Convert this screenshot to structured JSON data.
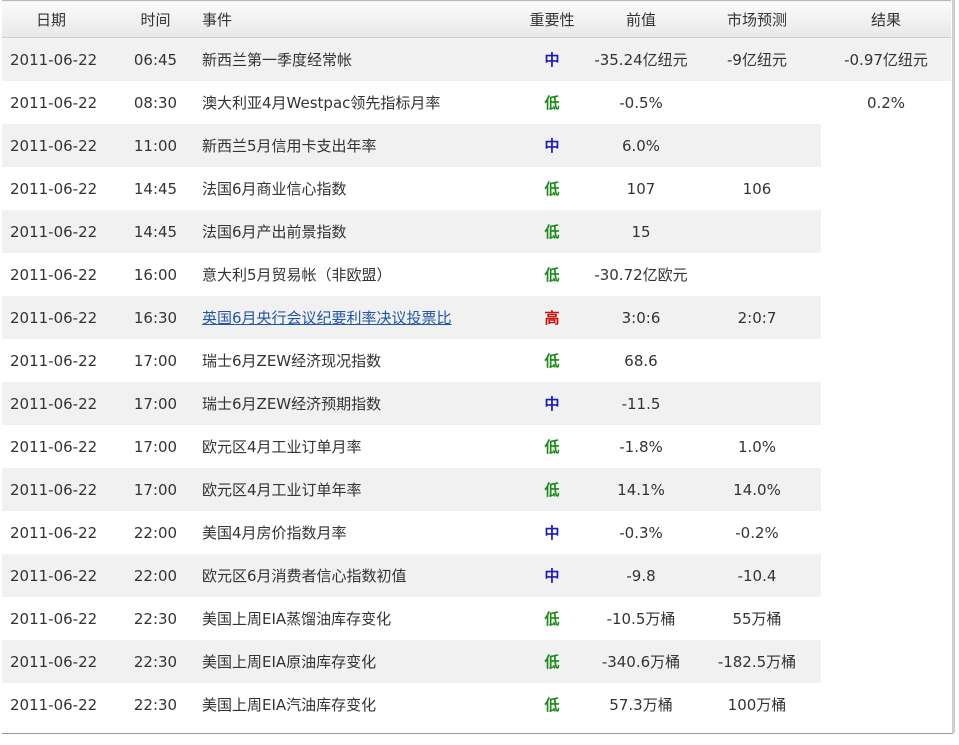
{
  "headers": {
    "date": "日期",
    "time": "时间",
    "event": "事件",
    "importance": "重要性",
    "previous": "前值",
    "forecast": "市场预测",
    "result": "结果"
  },
  "importance_colors": {
    "低": "#1b8a1b",
    "中": "#1a1ab8",
    "高": "#cc1111"
  },
  "rows": [
    {
      "date": "2011-06-22",
      "time": "06:45",
      "event": "新西兰第一季度经常帐",
      "importance": "中",
      "previous": "-35.24亿纽元",
      "forecast": "-9亿纽元",
      "result": "-0.97亿纽元"
    },
    {
      "date": "2011-06-22",
      "time": "08:30",
      "event": "澳大利亚4月Westpac领先指标月率",
      "importance": "低",
      "previous": "-0.5%",
      "forecast": "",
      "result": "0.2%"
    },
    {
      "date": "2011-06-22",
      "time": "11:00",
      "event": "新西兰5月信用卡支出年率",
      "importance": "中",
      "previous": "6.0%",
      "forecast": "",
      "result": ""
    },
    {
      "date": "2011-06-22",
      "time": "14:45",
      "event": "法国6月商业信心指数",
      "importance": "低",
      "previous": "107",
      "forecast": "106",
      "result": ""
    },
    {
      "date": "2011-06-22",
      "time": "14:45",
      "event": "法国6月产出前景指数",
      "importance": "低",
      "previous": "15",
      "forecast": "",
      "result": ""
    },
    {
      "date": "2011-06-22",
      "time": "16:00",
      "event": "意大利5月贸易帐（非欧盟）",
      "importance": "低",
      "previous": "-30.72亿欧元",
      "forecast": "",
      "result": ""
    },
    {
      "date": "2011-06-22",
      "time": "16:30",
      "event": "英国6月央行会议纪要利率决议投票比",
      "importance": "高",
      "previous": "3:0:6",
      "forecast": "2:0:7",
      "result": "",
      "link": true
    },
    {
      "date": "2011-06-22",
      "time": "17:00",
      "event": "瑞士6月ZEW经济现况指数",
      "importance": "低",
      "previous": "68.6",
      "forecast": "",
      "result": ""
    },
    {
      "date": "2011-06-22",
      "time": "17:00",
      "event": "瑞士6月ZEW经济预期指数",
      "importance": "中",
      "previous": "-11.5",
      "forecast": "",
      "result": ""
    },
    {
      "date": "2011-06-22",
      "time": "17:00",
      "event": "欧元区4月工业订单月率",
      "importance": "低",
      "previous": "-1.8%",
      "forecast": "1.0%",
      "result": ""
    },
    {
      "date": "2011-06-22",
      "time": "17:00",
      "event": "欧元区4月工业订单年率",
      "importance": "低",
      "previous": "14.1%",
      "forecast": "14.0%",
      "result": ""
    },
    {
      "date": "2011-06-22",
      "time": "22:00",
      "event": "美国4月房价指数月率",
      "importance": "中",
      "previous": "-0.3%",
      "forecast": "-0.2%",
      "result": ""
    },
    {
      "date": "2011-06-22",
      "time": "22:00",
      "event": "欧元区6月消费者信心指数初值",
      "importance": "中",
      "previous": "-9.8",
      "forecast": "-10.4",
      "result": ""
    },
    {
      "date": "2011-06-22",
      "time": "22:30",
      "event": "美国上周EIA蒸馏油库存变化",
      "importance": "低",
      "previous": "-10.5万桶",
      "forecast": "55万桶",
      "result": ""
    },
    {
      "date": "2011-06-22",
      "time": "22:30",
      "event": "美国上周EIA原油库存变化",
      "importance": "低",
      "previous": "-340.6万桶",
      "forecast": "-182.5万桶",
      "result": ""
    },
    {
      "date": "2011-06-22",
      "time": "22:30",
      "event": "美国上周EIA汽油库存变化",
      "importance": "低",
      "previous": "57.3万桶",
      "forecast": "100万桶",
      "result": ""
    }
  ]
}
